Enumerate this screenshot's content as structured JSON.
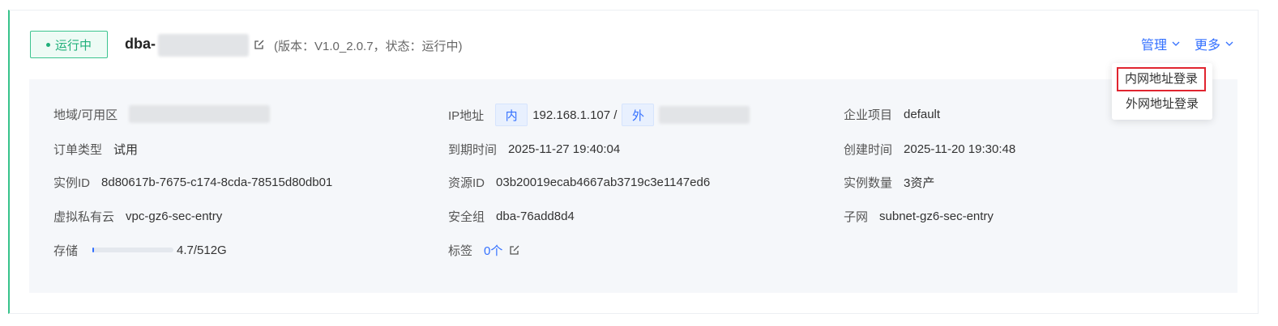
{
  "instance": {
    "status": "运行中",
    "name_prefix": "dba-",
    "version_info": "(版本：V1.0_2.0.7，状态：运行中)"
  },
  "actions": {
    "manage": "管理",
    "more": "更多"
  },
  "dropdown": {
    "items": [
      "内网地址登录",
      "外网地址登录"
    ]
  },
  "details": {
    "region": {
      "label": "地域/可用区"
    },
    "ip": {
      "label": "IP地址",
      "inner_tag": "内",
      "inner_ip": "192.168.1.107 /",
      "outer_tag": "外"
    },
    "project": {
      "label": "企业项目",
      "value": "default"
    },
    "order_type": {
      "label": "订单类型",
      "value": "试用"
    },
    "expire": {
      "label": "到期时间",
      "value": "2025-11-27 19:40:04"
    },
    "created": {
      "label": "创建时间",
      "value": "2025-11-20 19:30:48"
    },
    "instance_id": {
      "label": "实例ID",
      "value": "8d80617b-7675-c174-8cda-78515d80db01"
    },
    "resource_id": {
      "label": "资源ID",
      "value": "03b20019ecab4667ab3719c3e1147ed6"
    },
    "instance_count": {
      "label": "实例数量",
      "value": "3资产"
    },
    "vpc": {
      "label": "虚拟私有云",
      "value": "vpc-gz6-sec-entry"
    },
    "security_group": {
      "label": "安全组",
      "value": "dba-76add8d4"
    },
    "subnet": {
      "label": "子网",
      "value": "subnet-gz6-sec-entry"
    },
    "storage": {
      "label": "存储",
      "value": "4.7/512G",
      "used_fraction": 0.009
    },
    "tags": {
      "label": "标签",
      "value": "0个"
    }
  },
  "colors": {
    "accent": "#3370ff",
    "running": "#20b07a",
    "highlight_box": "#e0242f"
  }
}
